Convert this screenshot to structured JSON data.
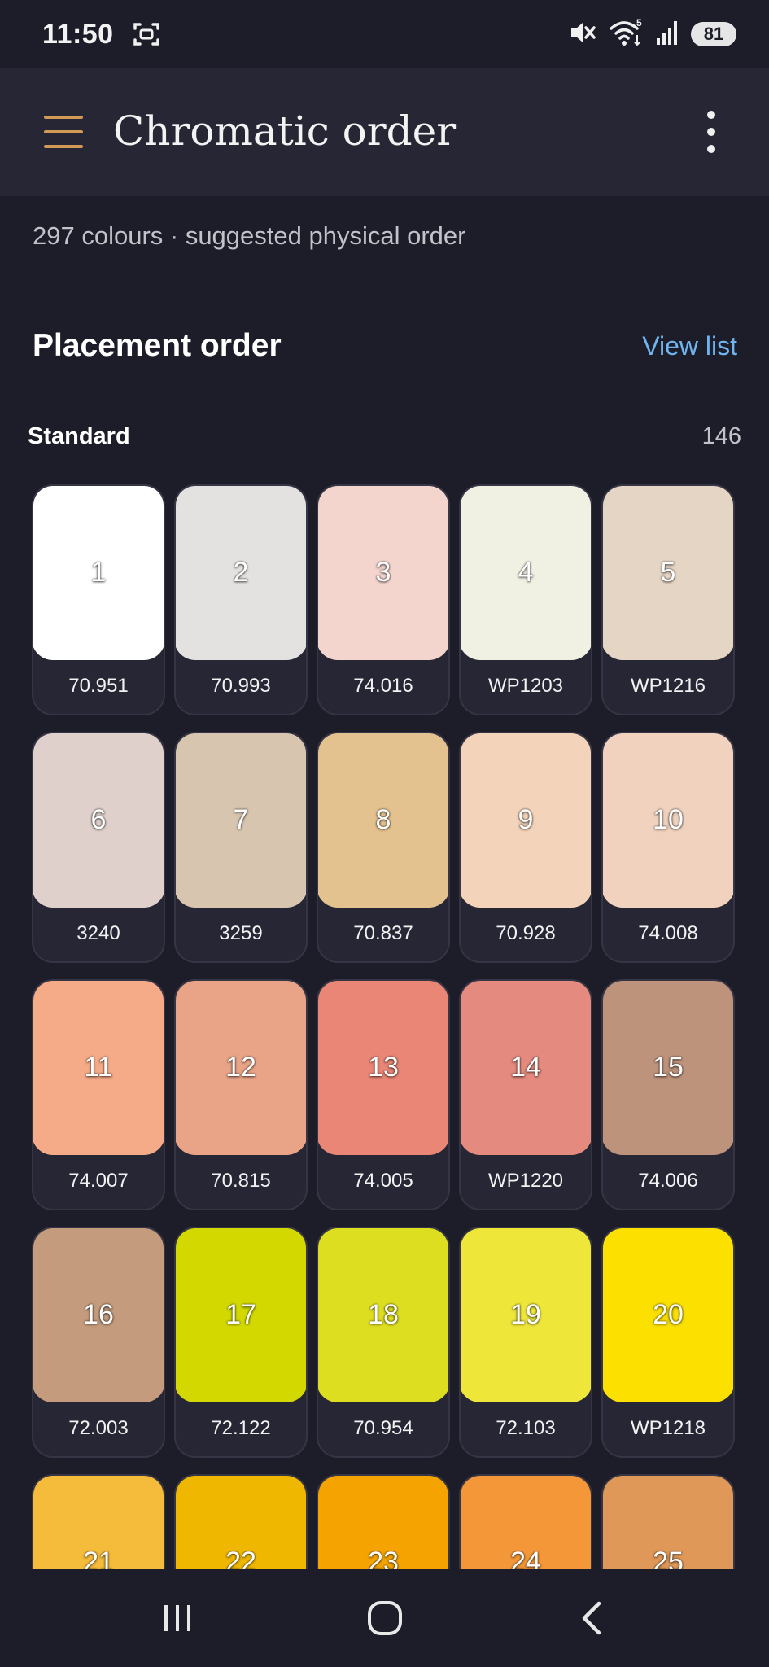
{
  "status_bar": {
    "time": "11:50",
    "battery": "81",
    "icons": [
      "screenshot-icon",
      "mute-icon",
      "wifi-icon",
      "signal-icon",
      "battery-icon"
    ]
  },
  "app_bar": {
    "title": "Chromatic order",
    "menu_icon": "hamburger-menu-icon",
    "overflow_icon": "more-vert-icon",
    "accent_color": "#d39a55"
  },
  "subtitle": "297 colours · suggested physical order",
  "section": {
    "title": "Placement order",
    "action_label": "View list",
    "action_color": "#6fb4f0"
  },
  "group": {
    "name": "Standard",
    "count": "146"
  },
  "swatches": [
    {
      "num": "1",
      "code": "70.951",
      "color": "#ffffff"
    },
    {
      "num": "2",
      "code": "70.993",
      "color": "#e3e2e1"
    },
    {
      "num": "3",
      "code": "74.016",
      "color": "#f4d5cd"
    },
    {
      "num": "4",
      "code": "WP1203",
      "color": "#f0f0e3"
    },
    {
      "num": "5",
      "code": "WP1216",
      "color": "#e5d5c5"
    },
    {
      "num": "6",
      "code": "3240",
      "color": "#dfd0cb"
    },
    {
      "num": "7",
      "code": "3259",
      "color": "#d7c5b0"
    },
    {
      "num": "8",
      "code": "70.837",
      "color": "#e3c28f"
    },
    {
      "num": "9",
      "code": "70.928",
      "color": "#f3d3b9"
    },
    {
      "num": "10",
      "code": "74.008",
      "color": "#f0d2be"
    },
    {
      "num": "11",
      "code": "74.007",
      "color": "#f5aa88"
    },
    {
      "num": "12",
      "code": "70.815",
      "color": "#e9a487"
    },
    {
      "num": "13",
      "code": "74.005",
      "color": "#e98675"
    },
    {
      "num": "14",
      "code": "WP1220",
      "color": "#e48a7e"
    },
    {
      "num": "15",
      "code": "74.006",
      "color": "#be937c"
    },
    {
      "num": "16",
      "code": "72.003",
      "color": "#c49b7c"
    },
    {
      "num": "17",
      "code": "72.122",
      "color": "#d3d900"
    },
    {
      "num": "18",
      "code": "70.954",
      "color": "#dede21"
    },
    {
      "num": "19",
      "code": "72.103",
      "color": "#efe63a"
    },
    {
      "num": "20",
      "code": "WP1218",
      "color": "#fbe000"
    },
    {
      "num": "21",
      "code": "",
      "color": "#f5bb3a"
    },
    {
      "num": "22",
      "code": "",
      "color": "#f0b700"
    },
    {
      "num": "23",
      "code": "",
      "color": "#f5a300"
    },
    {
      "num": "24",
      "code": "",
      "color": "#f39738"
    },
    {
      "num": "25",
      "code": "",
      "color": "#e09858"
    }
  ],
  "nav_bar": {
    "icons": [
      "recent-apps-icon",
      "home-icon",
      "back-icon"
    ]
  }
}
